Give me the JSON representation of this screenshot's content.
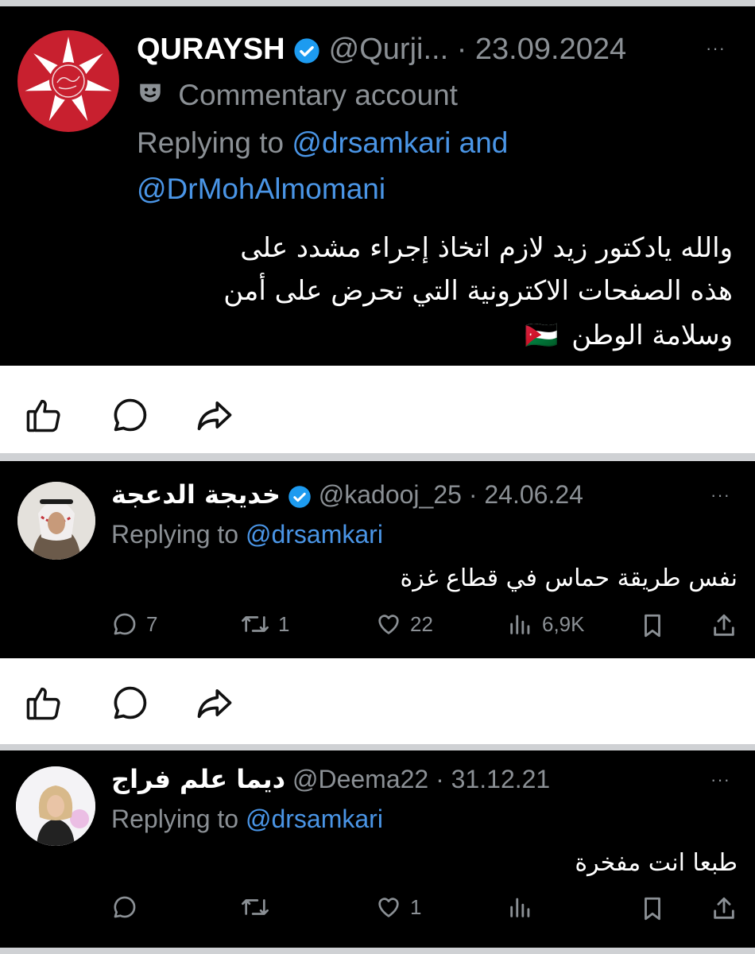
{
  "tweet1": {
    "name": "QURAYSH",
    "handle": "@Qurji...",
    "date": "· 23.09.2024",
    "more": "···",
    "badge_icon": "theater-masks-icon",
    "label": "Commentary account",
    "replying_prefix": "Replying to ",
    "replying_to_1": "@drsamkari and",
    "replying_to_2": "@DrMohAlmomani",
    "text_line_1": "والله يادكتور زيد لازم اتخاذ إجراء مشدد على",
    "text_line_2": "هذه الصفحات الاكترونية التي تحرض على أمن",
    "text_line_3": "وسلامة الوطن",
    "flag": "🇯🇴"
  },
  "actions1": {
    "icons": [
      "thumbs-up-icon",
      "comment-icon",
      "share-icon"
    ]
  },
  "tweet2": {
    "name": "خديجة الدعجة",
    "handle": "@kadooj_25",
    "date": "· 24.06.24",
    "more": "···",
    "replying_prefix": "Replying to ",
    "replying_to": "@drsamkari",
    "text": "نفس طريقة حماس في قطاع غزة",
    "replies": "7",
    "retweets": "1",
    "likes": "22",
    "views": "6,9K"
  },
  "actions2": {
    "icons": [
      "thumbs-up-icon",
      "comment-icon",
      "share-icon"
    ]
  },
  "tweet3": {
    "name": "ديما علم فراج",
    "handle": "@Deema22",
    "date": "· 31.12.21",
    "more": "···",
    "replying_prefix": "Replying to ",
    "replying_to": "@drsamkari",
    "text": "طبعا انت مفخرة",
    "likes": "1"
  },
  "colors": {
    "background": "#000000",
    "link": "#4a95e6",
    "muted": "#8b9095",
    "verified": "#1d9bf0",
    "logo_red": "#c8202f"
  }
}
